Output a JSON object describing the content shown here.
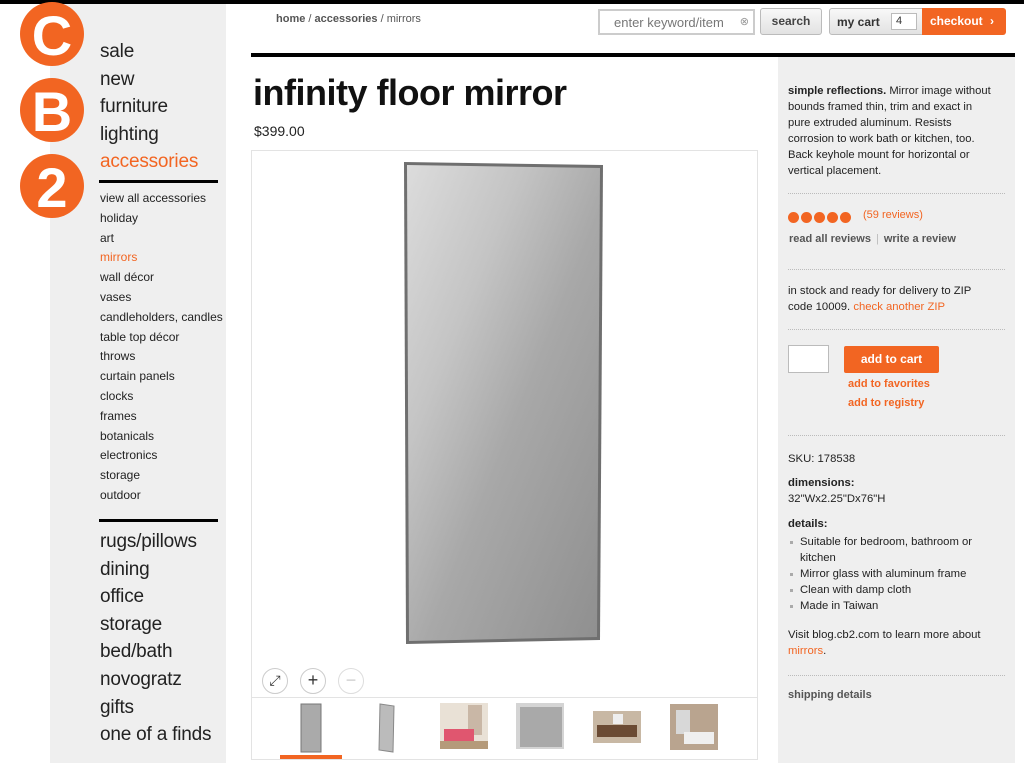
{
  "logo": {
    "letters": [
      "C",
      "B",
      "2"
    ],
    "color": "#f26522"
  },
  "sidebar": {
    "top_categories": [
      {
        "label": "sale",
        "active": false
      },
      {
        "label": "new",
        "active": false
      },
      {
        "label": "furniture",
        "active": false
      },
      {
        "label": "lighting",
        "active": false
      },
      {
        "label": "accessories",
        "active": true
      }
    ],
    "subcategories": [
      {
        "label": "view all accessories",
        "active": false
      },
      {
        "label": "holiday",
        "active": false
      },
      {
        "label": "art",
        "active": false
      },
      {
        "label": "mirrors",
        "active": true
      },
      {
        "label": "wall décor",
        "active": false
      },
      {
        "label": "vases",
        "active": false
      },
      {
        "label": "candleholders, candles",
        "active": false
      },
      {
        "label": "table top décor",
        "active": false
      },
      {
        "label": "throws",
        "active": false
      },
      {
        "label": "curtain panels",
        "active": false
      },
      {
        "label": "clocks",
        "active": false
      },
      {
        "label": "frames",
        "active": false
      },
      {
        "label": "botanicals",
        "active": false
      },
      {
        "label": "electronics",
        "active": false
      },
      {
        "label": "storage",
        "active": false
      },
      {
        "label": "outdoor",
        "active": false
      }
    ],
    "bottom_categories": [
      "rugs/pillows",
      "dining",
      "office",
      "storage",
      "bed/bath",
      "novogratz",
      "gifts",
      "one of a finds"
    ]
  },
  "header": {
    "breadcrumb": {
      "home": "home",
      "sep1": " / ",
      "accessories": "accessories",
      "sep2": " / ",
      "current": "mirrors"
    },
    "search_placeholder": "enter keyword/item",
    "search_label": "search",
    "cart_label": "my cart",
    "cart_count": "4",
    "checkout_label": "checkout",
    "checkout_arrow": "›"
  },
  "product": {
    "title": "infinity floor mirror",
    "price": "$399.00",
    "zoom_expand": "⤢",
    "zoom_in": "+",
    "zoom_out": "−",
    "description_lead": "simple reflections.",
    "description": " Mirror image without bounds framed thin, trim and exact in pure extruded aluminum. Resists corrosion to work bath or kitchen, too. Back keyhole mount for horizontal or vertical placement.",
    "rating_stars": 5,
    "reviews_count": "(59 reviews)",
    "read_reviews": "read all reviews",
    "review_sep": "|",
    "write_review": "write a review",
    "stock_text": "in stock and ready for delivery to ZIP code 10009.",
    "check_zip": "check another ZIP",
    "add_to_cart": "add to cart",
    "add_favorites": "add to favorites",
    "add_registry": "add to registry",
    "sku": "SKU: 178538",
    "dimensions_label": "dimensions:",
    "dimensions": "32\"Wx2.25\"Dx76\"H",
    "details_label": "details:",
    "details": [
      "Suitable for bedroom, bathroom or kitchen",
      "Mirror glass with aluminum frame",
      "Clean with damp cloth",
      "Made in Taiwan"
    ],
    "blog_text": "Visit blog.cb2.com to learn more about",
    "blog_link": "mirrors",
    "blog_end": ".",
    "shipping": "shipping details"
  },
  "colors": {
    "accent": "#f26522",
    "panel": "#efefef"
  }
}
